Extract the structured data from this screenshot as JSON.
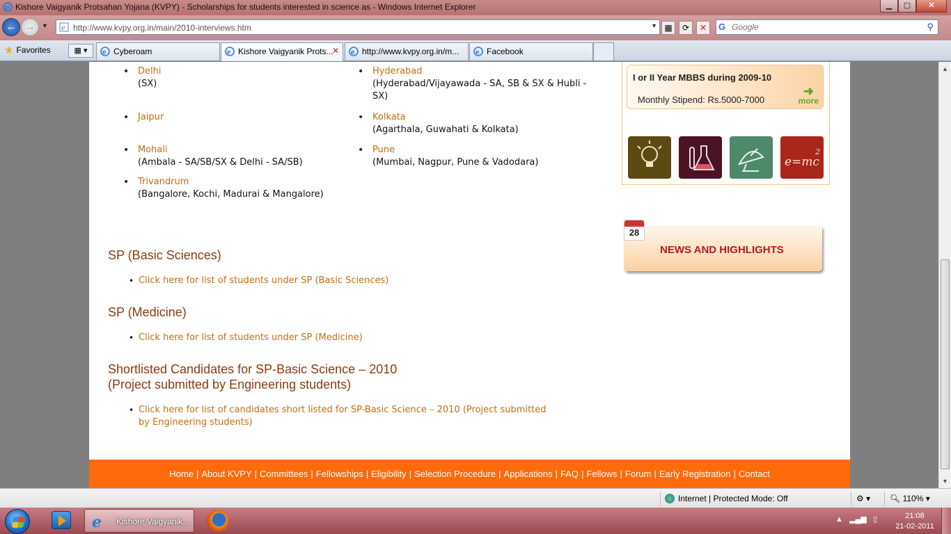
{
  "window": {
    "title": "Kishore Vaigyanik Protsahan Yojana (KVPY) - Scholarships for students interested in science as  - Windows Internet Explorer",
    "min": "▁",
    "max": "▢",
    "close": "✕"
  },
  "address": {
    "url": "http://www.kvpy.org.in/main/2010-interviews.htm",
    "search_placeholder": "Google"
  },
  "tabs": {
    "favorites_label": "Favorites",
    "items": [
      {
        "label": "Cyberoam"
      },
      {
        "label": "Kishore Vaigyanik Prots..."
      },
      {
        "label": "http://www.kvpy.org.in/m..."
      },
      {
        "label": "Facebook"
      }
    ]
  },
  "cities": [
    {
      "name": "Delhi",
      "detail": "(SX)"
    },
    {
      "name": "Hyderabad",
      "detail": "(Hyderabad/Vijayawada - SA, SB & SX & Hubli - SX)"
    },
    {
      "name": "Jaipur",
      "detail": ""
    },
    {
      "name": "Kolkata",
      "detail": "(Agarthala, Guwahati & Kolkata)"
    },
    {
      "name": "Mohali",
      "detail": "(Ambala - SA/SB/SX & Delhi - SA/SB)"
    },
    {
      "name": "Pune",
      "detail": "(Mumbai, Nagpur, Pune & Vadodara)"
    },
    {
      "name": "Trivandrum",
      "detail": "(Bangalore, Kochi, Madurai & Mangalore)"
    }
  ],
  "sections": [
    {
      "heading": "SP (Basic Sciences)",
      "link": "Click here for list of students under SP (Basic Sciences)"
    },
    {
      "heading": "SP (Medicine)",
      "link": "Click here for list of students under SP (Medicine)"
    },
    {
      "heading_line1": "Shortlisted Candidates for SP-Basic Science – 2010",
      "heading_line2": "(Project submitted by Engineering students)",
      "link_line1": "Click here for list of candidates short listed for SP-Basic Science – 2010 (Project submitted",
      "link_line2": "by Engineering students)"
    }
  ],
  "sidebar": {
    "mbbs_title": "I or II Year MBBS during 2009-10",
    "stipend": "Monthly Stipend: Rs.5000-7000",
    "more": "more",
    "news_title": "NEWS AND HIGHLIGHTS",
    "cal_day": "28",
    "tile_colors": [
      "#5b4a12",
      "#4a1424",
      "#4c8a6a",
      "#a8261a"
    ]
  },
  "footer": {
    "links": [
      "Home",
      "About KVPY",
      "Committees",
      "Fellowships",
      "Eligibility",
      "Selection Procedure",
      "Applications",
      "FAQ",
      "Fellows",
      "Forum",
      "Early Registration",
      "Contact"
    ]
  },
  "status": {
    "zone": "Internet | Protected Mode: Off",
    "zoom": "110%"
  },
  "taskbar": {
    "ie_label": "Kishore Vaigyanik...",
    "time": "21:08",
    "date": "21-02-2011"
  }
}
